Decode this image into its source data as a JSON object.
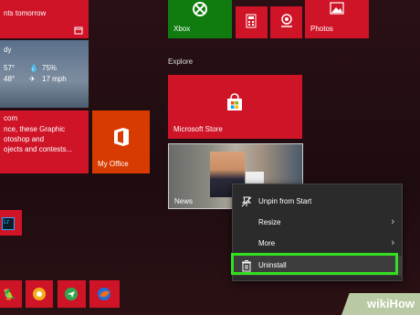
{
  "tiles": {
    "calendar_text": "nts tomorrow",
    "weather_city": "dy",
    "weather_temp_hi": "57°",
    "weather_temp_lo": "48°",
    "weather_humidity": "75%",
    "weather_wind": "17 mph",
    "news_title": "com",
    "news_line1": "nce, these Graphic",
    "news_line2": "otoshop and",
    "news_line3": "ojects and contests...",
    "my_office": "My Office",
    "xbox": "Xbox",
    "photos": "Photos",
    "microsoft_store": "Microsoft Store",
    "news": "News",
    "lr": "Lr"
  },
  "section_explore": "Explore",
  "context_menu": {
    "items": [
      {
        "label": "Unpin from Start",
        "icon": "unpin-icon",
        "has_submenu": false
      },
      {
        "label": "Resize",
        "icon": "",
        "has_submenu": true
      },
      {
        "label": "More",
        "icon": "",
        "has_submenu": true
      },
      {
        "label": "Uninstall",
        "icon": "trash-icon",
        "has_submenu": false
      }
    ]
  },
  "watermark": "wikiHow",
  "colors": {
    "tile_red": "#cf1427",
    "xbox_green": "#107c10",
    "office_orange": "#d83b01",
    "highlight": "#33e01f"
  }
}
